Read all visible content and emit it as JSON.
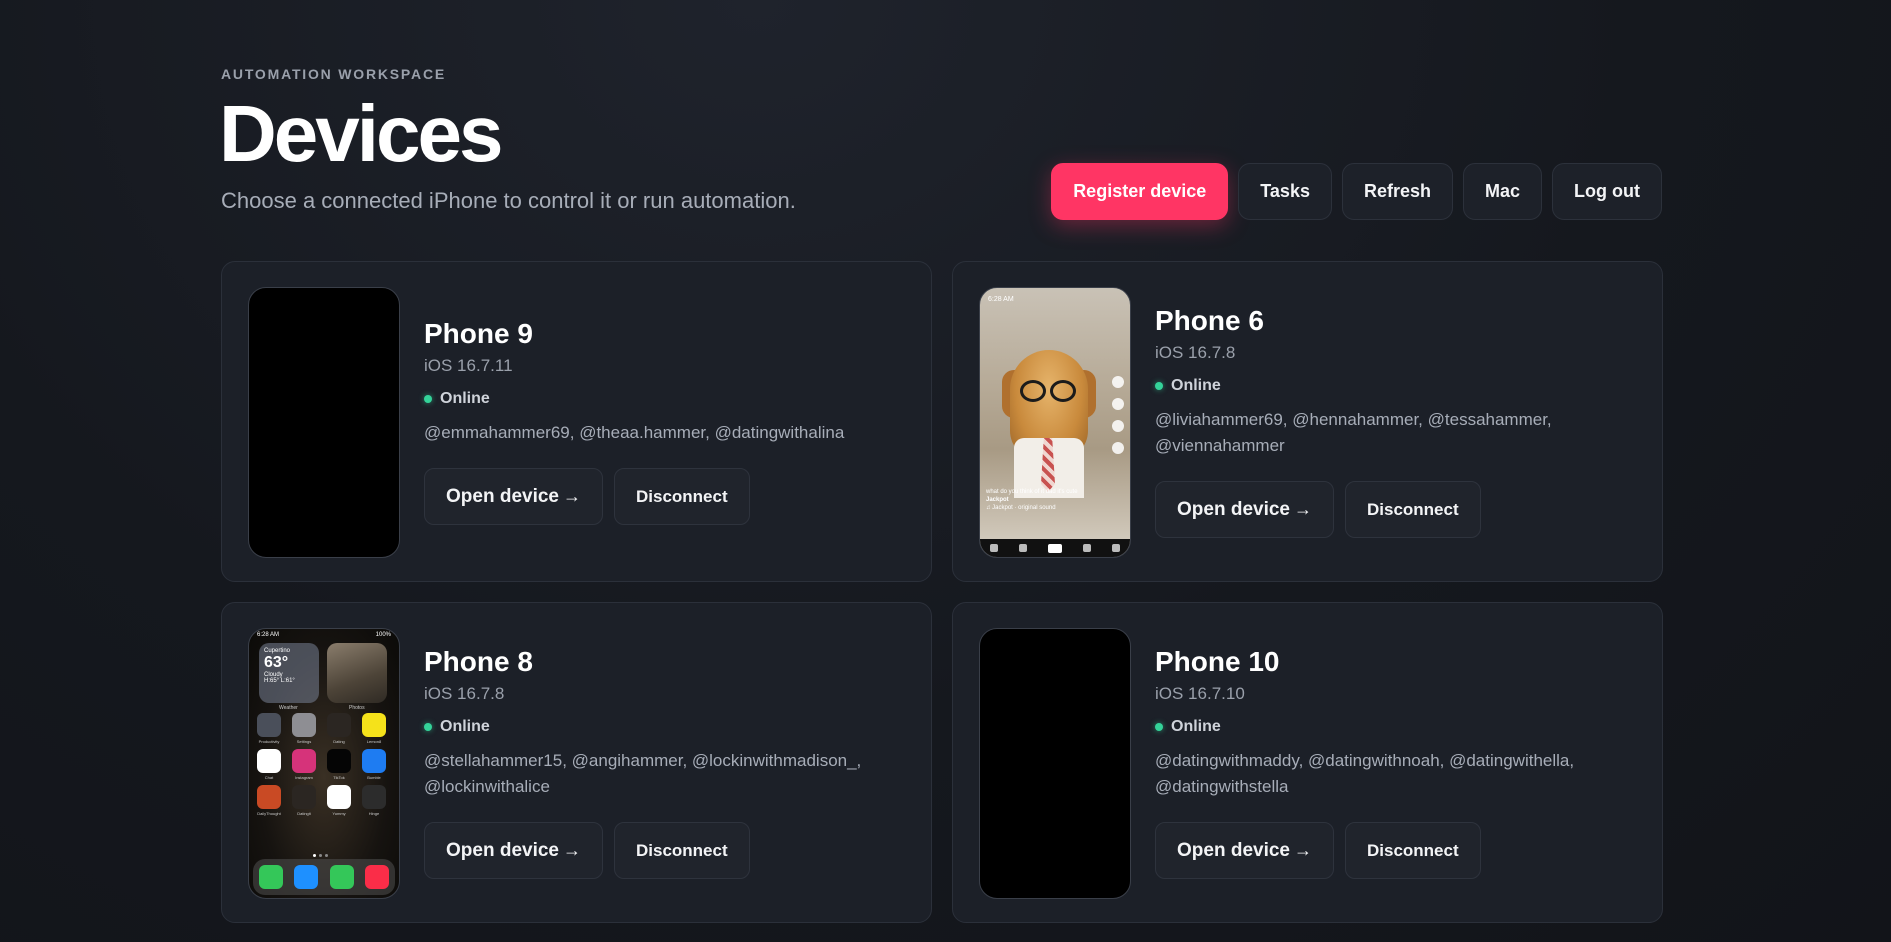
{
  "header": {
    "eyebrow": "AUTOMATION WORKSPACE",
    "title": "Devices",
    "subtitle": "Choose a connected iPhone to control it or run automation."
  },
  "toolbar": {
    "register": "Register device",
    "tasks": "Tasks",
    "refresh": "Refresh",
    "mac": "Mac",
    "logout": "Log out"
  },
  "colors": {
    "accent": "#ff3564",
    "online": "#34d399",
    "card_bg": "#1c2028"
  },
  "devices": [
    {
      "name": "Phone 9",
      "ios": "iOS 16.7.11",
      "status": "Online",
      "accounts": "@emmahammer69, @theaa.hammer, @datingwithalina",
      "open_label": "Open device",
      "disconnect_label": "Disconnect",
      "screen": "blank"
    },
    {
      "name": "Phone 6",
      "ios": "iOS 16.7.8",
      "status": "Online",
      "accounts": "@liviahammer69, @hennahammer, @tessahammer, @viennahammer",
      "open_label": "Open device",
      "disconnect_label": "Disconnect",
      "screen": "tiktok-video"
    },
    {
      "name": "Phone 8",
      "ios": "iOS 16.7.8",
      "status": "Online",
      "accounts": "@stellahammer15, @angihammer, @lockinwithmadison_, @lockinwithalice",
      "open_label": "Open device",
      "disconnect_label": "Disconnect",
      "screen": "home-screen"
    },
    {
      "name": "Phone 10",
      "ios": "iOS 16.7.10",
      "status": "Online",
      "accounts": "@datingwithmaddy, @datingwithnoah, @datingwithella, @datingwithstella",
      "open_label": "Open device",
      "disconnect_label": "Disconnect",
      "screen": "blank"
    }
  ],
  "phone6_screen": {
    "time": "6:28 AM",
    "caption_title": "Jackpot",
    "caption_text": "what do you think of it dad it's cute",
    "caption_line": "♫ Jackpot · original sound"
  },
  "phone8_screen": {
    "time": "6:28 AM",
    "battery": "100%",
    "weather_city": "Cupertino",
    "weather_temp": "63°",
    "weather_cond": "Cloudy",
    "weather_range": "H:65° L:61°",
    "weather_label": "Weather",
    "photos_label": "Photos",
    "apps": [
      {
        "label": "Productivity",
        "color": "#4a4f5a"
      },
      {
        "label": "Settings",
        "color": "#8e8e93"
      },
      {
        "label": "Dating",
        "color": "#2b2622"
      },
      {
        "label": "Lemon8",
        "color": "#f5e21a"
      },
      {
        "label": "Chat",
        "color": "#ffffff"
      },
      {
        "label": "Instagram",
        "color": "#d6337a"
      },
      {
        "label": "TikTok",
        "color": "#050505"
      },
      {
        "label": "Bumble",
        "color": "#1e7cf2"
      },
      {
        "label": "DailyThought",
        "color": "#c94a24"
      },
      {
        "label": "Datingit",
        "color": "#2b2622"
      },
      {
        "label": "Yummy",
        "color": "#ffffff"
      },
      {
        "label": "Hinge",
        "color": "#2c2c2c"
      }
    ],
    "dock": [
      {
        "label": "Phone",
        "color": "#34c759"
      },
      {
        "label": "Safari",
        "color": "#1e90ff"
      },
      {
        "label": "Messages",
        "color": "#34c759"
      },
      {
        "label": "Music",
        "color": "#fa2d48"
      }
    ]
  }
}
